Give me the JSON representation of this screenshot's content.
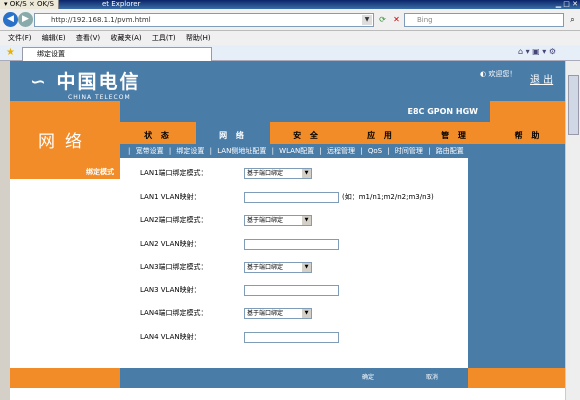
{
  "ie": {
    "title": "et Explorer",
    "popup_tabs": [
      "OK/S",
      "OK/S"
    ],
    "address": "http://192.168.1.1/pvm.html",
    "search_placeholder": "Bing",
    "menu": [
      "文件(F)",
      "编辑(E)",
      "查看(V)",
      "收藏夹(A)",
      "工具(T)",
      "帮助(H)"
    ],
    "tab_title": "绑定设置"
  },
  "brand": {
    "cn": "中国电信",
    "en": "CHINA TELECOM"
  },
  "header": {
    "welcome": "欢迎您！",
    "logout": "退 出",
    "product": "E8C GPON HGW"
  },
  "category": "网络",
  "main_tabs": [
    "状 态",
    "网 络",
    "安 全",
    "应 用",
    "管 理",
    "帮 助"
  ],
  "sub_tabs": [
    "宽带设置",
    "绑定设置",
    "LAN侧地址配置",
    "WLAN配置",
    "远程管理",
    "QoS",
    "时间管理",
    "路由配置"
  ],
  "left_heading": "绑定模式",
  "form": {
    "rows": [
      {
        "label": "LAN1端口绑定模式：",
        "type": "select",
        "value": "基于端口绑定"
      },
      {
        "label": "LAN1 VLAN映射：",
        "type": "input",
        "value": "",
        "hint": "(如：m1/n1;m2/n2;m3/n3)"
      },
      {
        "label": "LAN2端口绑定模式：",
        "type": "select",
        "value": "基于端口绑定"
      },
      {
        "label": "LAN2 VLAN映射：",
        "type": "input",
        "value": ""
      },
      {
        "label": "LAN3端口绑定模式：",
        "type": "select",
        "value": "基于端口绑定"
      },
      {
        "label": "LAN3 VLAN映射：",
        "type": "input",
        "value": ""
      },
      {
        "label": "LAN4端口绑定模式：",
        "type": "select",
        "value": "基于端口绑定"
      },
      {
        "label": "LAN4 VLAN映射：",
        "type": "input",
        "value": ""
      }
    ]
  },
  "footer": {
    "ok": "确定",
    "cancel": "取消"
  }
}
